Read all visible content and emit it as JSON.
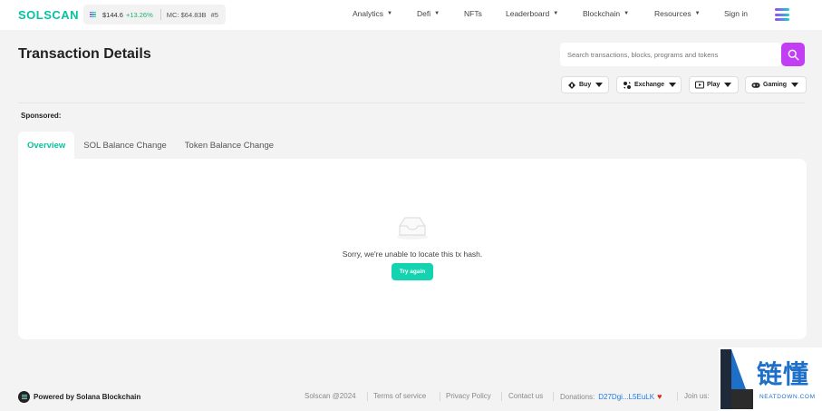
{
  "header": {
    "logo": "SOLSCAN",
    "price": "$144.6",
    "price_change": "+13.26%",
    "market_cap": "MC: $64.83B",
    "rank": "#5",
    "nav": [
      {
        "label": "Analytics",
        "has_caret": true
      },
      {
        "label": "Defi",
        "has_caret": true
      },
      {
        "label": "NFTs",
        "has_caret": false
      },
      {
        "label": "Leaderboard",
        "has_caret": true
      },
      {
        "label": "Blockchain",
        "has_caret": true
      },
      {
        "label": "Resources",
        "has_caret": true
      },
      {
        "label": "Sign in",
        "has_caret": false
      }
    ],
    "menu_icon": "solana-logo-icon"
  },
  "page": {
    "title": "Transaction Details",
    "search_placeholder": "Search transactions, blocks, programs and tokens",
    "chips": [
      {
        "label": "Buy",
        "icon": "buy-icon"
      },
      {
        "label": "Exchange",
        "icon": "exchange-icon"
      },
      {
        "label": "Play",
        "icon": "play-icon"
      },
      {
        "label": "Gaming",
        "icon": "gamepad-icon"
      }
    ],
    "sponsored": "Sponsored:"
  },
  "tabs": [
    "Overview",
    "SOL Balance Change",
    "Token Balance Change"
  ],
  "active_tab": 0,
  "card": {
    "message": "Sorry, we're unable to locate this tx hash.",
    "button": "Try again",
    "icon": "empty-inbox-icon"
  },
  "footer": {
    "powered_by": "Powered by Solana Blockchain",
    "links": [
      "Solscan @2024",
      "Terms of service",
      "Privacy Policy",
      "Contact us"
    ],
    "donations_label": "Donations:",
    "donation_address": "D27Dgi...L5EuLK",
    "join_us": "Join us:"
  },
  "watermark": {
    "chinese": "链懂",
    "english": "NEATDOWN.COM"
  },
  "colors": {
    "accent": "#07c2a0",
    "search_button": "#c13ef4",
    "try_again": "#13d3b0",
    "price_up": "#18b46b",
    "link": "#1d7be5"
  }
}
